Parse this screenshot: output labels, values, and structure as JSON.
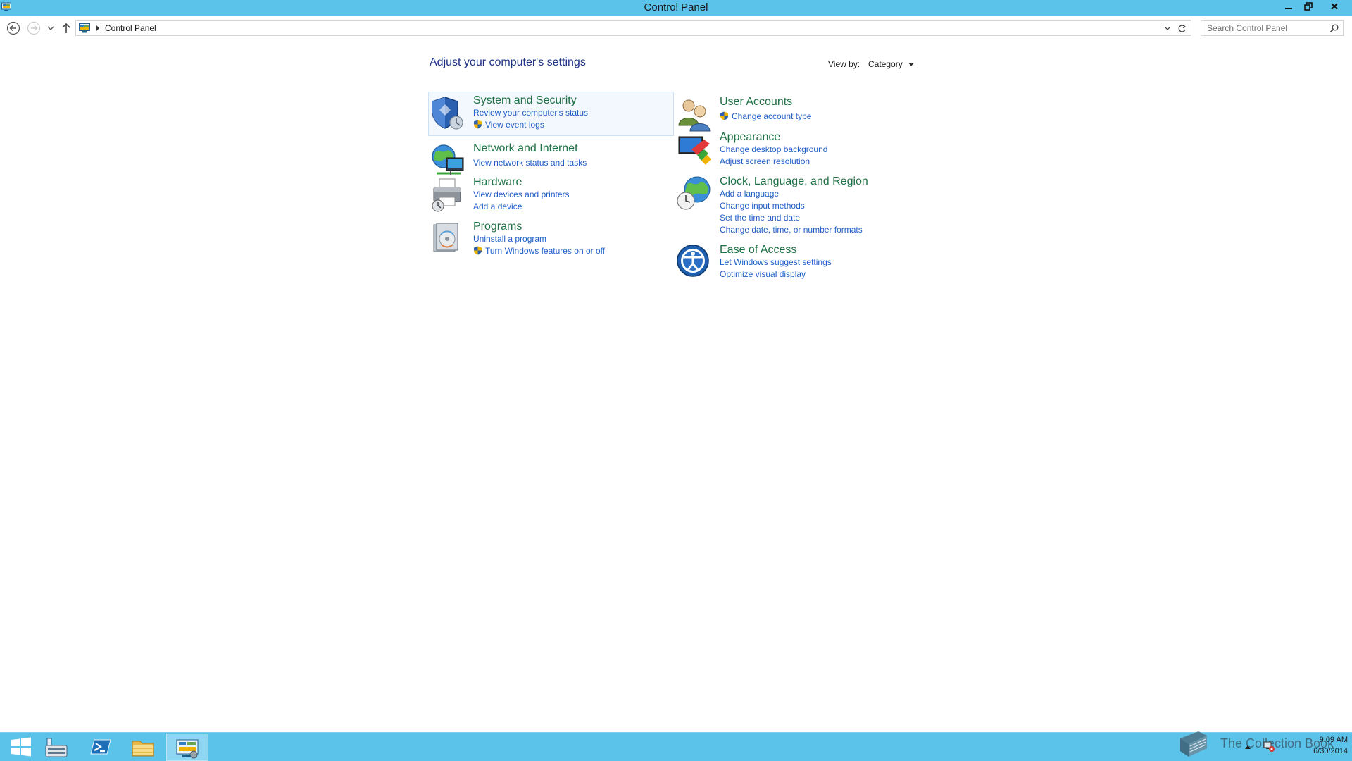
{
  "window": {
    "title": "Control Panel",
    "colors": {
      "title_bar": "#5bc3e9",
      "heading": "#1e3287",
      "category_title": "#1e7145",
      "link": "#1e5ec8"
    }
  },
  "address_bar": {
    "breadcrumb": "Control Panel",
    "search_placeholder": "Search Control Panel"
  },
  "content": {
    "heading": "Adjust your computer's settings",
    "view_by_label": "View by:",
    "view_by_value": "Category",
    "categories": [
      {
        "title": "System and Security",
        "icon": "shield-icon",
        "links": [
          {
            "label": "Review your computer's status",
            "shield": false
          },
          {
            "label": "View event logs",
            "shield": true
          }
        ]
      },
      {
        "title": "Network and Internet",
        "icon": "network-globe-icon",
        "links": [
          {
            "label": "View network status and tasks",
            "shield": false
          }
        ]
      },
      {
        "title": "Hardware",
        "icon": "printer-icon",
        "links": [
          {
            "label": "View devices and printers",
            "shield": false
          },
          {
            "label": "Add a device",
            "shield": false
          }
        ]
      },
      {
        "title": "Programs",
        "icon": "programs-icon",
        "links": [
          {
            "label": "Uninstall a program",
            "shield": false
          },
          {
            "label": "Turn Windows features on or off",
            "shield": true
          }
        ]
      },
      {
        "title": "User Accounts",
        "icon": "users-icon",
        "links": [
          {
            "label": "Change account type",
            "shield": true
          }
        ]
      },
      {
        "title": "Appearance",
        "icon": "appearance-icon",
        "links": [
          {
            "label": "Change desktop background",
            "shield": false
          },
          {
            "label": "Adjust screen resolution",
            "shield": false
          }
        ]
      },
      {
        "title": "Clock, Language, and Region",
        "icon": "clock-globe-icon",
        "links": [
          {
            "label": "Add a language",
            "shield": false
          },
          {
            "label": "Change input methods",
            "shield": false
          },
          {
            "label": "Set the time and date",
            "shield": false
          },
          {
            "label": "Change date, time, or number formats",
            "shield": false
          }
        ]
      },
      {
        "title": "Ease of Access",
        "icon": "ease-of-access-icon",
        "links": [
          {
            "label": "Let Windows suggest settings",
            "shield": false
          },
          {
            "label": "Optimize visual display",
            "shield": false
          }
        ]
      }
    ]
  },
  "taskbar": {
    "items": [
      "start-button",
      "server-manager",
      "powershell",
      "file-explorer",
      "control-panel"
    ],
    "watermark": "The Collection Book",
    "time": "9:09 AM",
    "date": "6/30/2014"
  }
}
